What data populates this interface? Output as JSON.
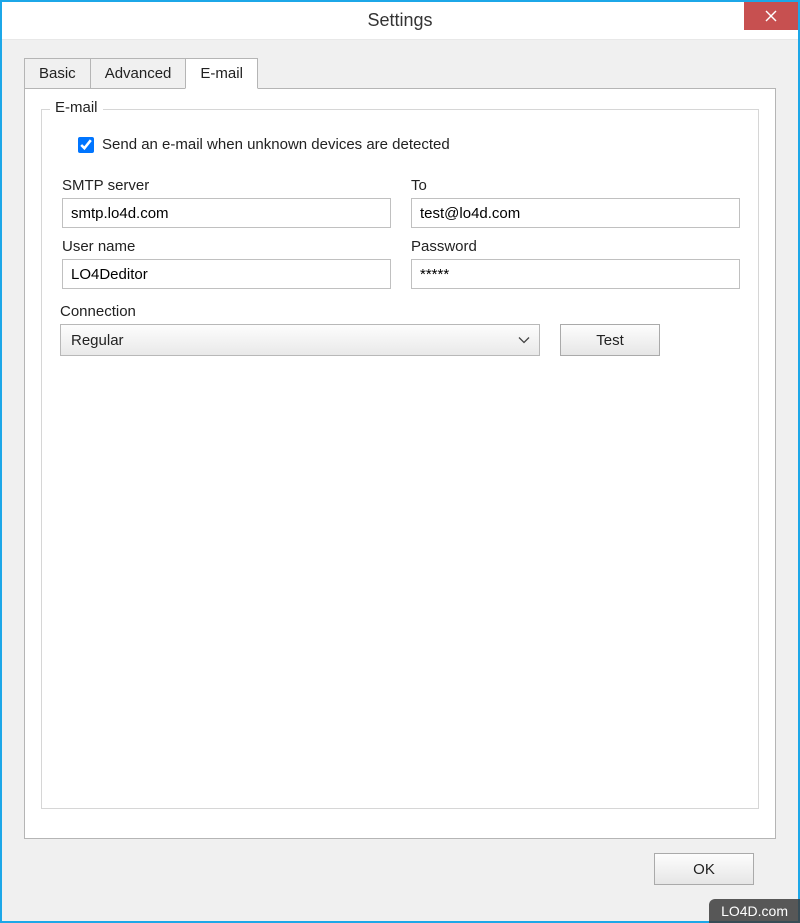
{
  "window": {
    "title": "Settings"
  },
  "tabs": {
    "basic": "Basic",
    "advanced": "Advanced",
    "email": "E-mail"
  },
  "groupbox": {
    "title": "E-mail"
  },
  "checkbox": {
    "send_email_label": "Send an e-mail when unknown devices are detected",
    "checked": true
  },
  "fields": {
    "smtp_label": "SMTP server",
    "smtp_value": "smtp.lo4d.com",
    "to_label": "To",
    "to_value": "test@lo4d.com",
    "username_label": "User name",
    "username_value": "LO4Deditor",
    "password_label": "Password",
    "password_value": "*****",
    "connection_label": "Connection",
    "connection_value": "Regular"
  },
  "buttons": {
    "test": "Test",
    "ok": "OK"
  },
  "watermark": "LO4D.com"
}
